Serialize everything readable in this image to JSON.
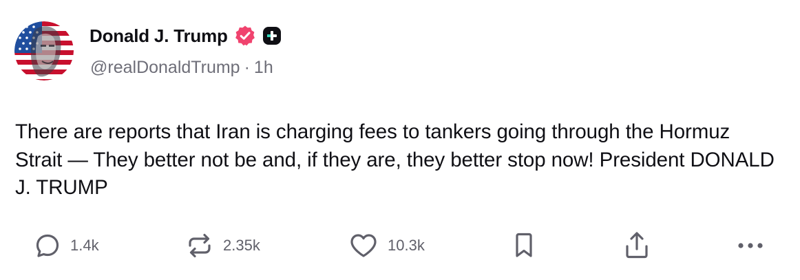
{
  "author": {
    "display_name": "Donald J. Trump",
    "handle": "@realDonaldTrump",
    "separator": "·",
    "time": "1h",
    "avatar_icon": "flag-portrait-avatar",
    "verified_icon": "verified-badge-icon",
    "verified_color": "#f0436e",
    "plus_badge_icon": "plus-badge-icon"
  },
  "post": {
    "text": "There are reports that Iran is charging fees to tankers going through the Hormuz Strait — They better not be and, if they are, they better stop now! President DONALD J. TRUMP"
  },
  "actions": {
    "reply": {
      "icon": "reply-icon",
      "count": "1.4k"
    },
    "repost": {
      "icon": "repost-icon",
      "count": "2.35k"
    },
    "like": {
      "icon": "heart-icon",
      "count": "10.3k"
    },
    "bookmark": {
      "icon": "bookmark-icon"
    },
    "share": {
      "icon": "share-icon"
    },
    "more": {
      "icon": "more-icon"
    }
  },
  "colors": {
    "text": "#0f0f14",
    "secondary": "#6e6e78",
    "icon": "#60606a"
  }
}
